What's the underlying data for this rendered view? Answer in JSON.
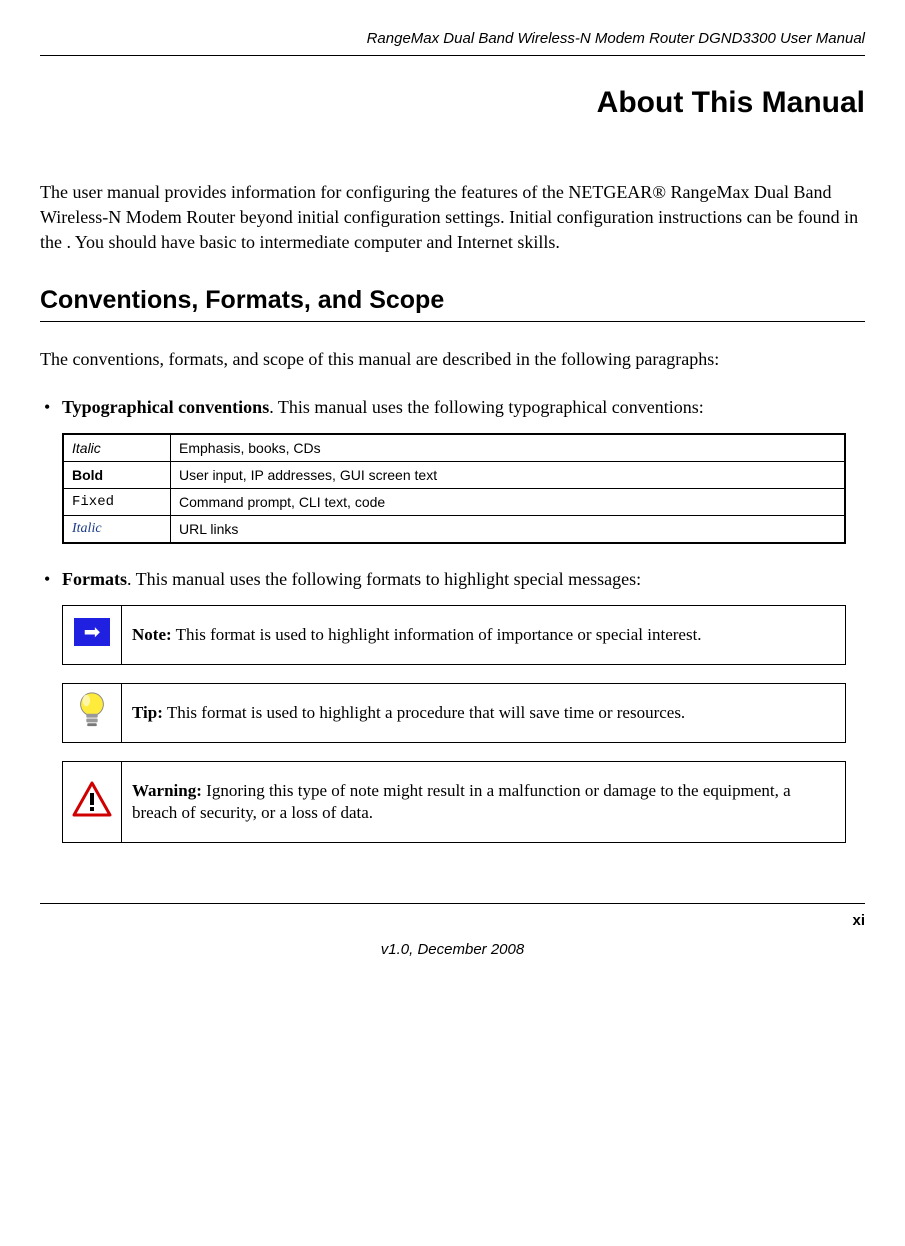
{
  "header": "RangeMax Dual Band Wireless-N Modem Router DGND3300 User Manual",
  "title": "About This Manual",
  "intro": "The user manual provides information for configuring the features of the NETGEAR® RangeMax Dual Band Wireless-N Modem Router beyond initial configuration settings. Initial configuration instructions can be found in the  . You should have basic to intermediate computer and Internet skills.",
  "section_heading": "Conventions, Formats, and Scope",
  "section_intro": "The conventions, formats, and scope of this manual are described in the following paragraphs:",
  "bullets": {
    "typo_label": "Typographical conventions",
    "typo_tail": ". This manual uses the following typographical conventions:",
    "formats_label": "Formats",
    "formats_tail": ". This manual uses the following formats to highlight special messages:"
  },
  "conv_table": [
    {
      "left": "Italic",
      "right": "Emphasis, books, CDs"
    },
    {
      "left": "Bold",
      "right": "User input, IP addresses, GUI screen text"
    },
    {
      "left": "Fixed",
      "right": "Command prompt, CLI text, code"
    },
    {
      "left": "Italic",
      "right": "URL links"
    }
  ],
  "callouts": {
    "note_label": "Note:",
    "note_text": " This format is used to highlight information of importance or special interest.",
    "tip_label": "Tip:",
    "tip_text": " This format is used to highlight a procedure that will save time or resources.",
    "warn_label": "Warning:",
    "warn_text": " Ignoring this type of note might result in a malfunction or damage to the equipment, a breach of security, or a loss of data."
  },
  "page_number": "xi",
  "version": "v1.0, December 2008"
}
